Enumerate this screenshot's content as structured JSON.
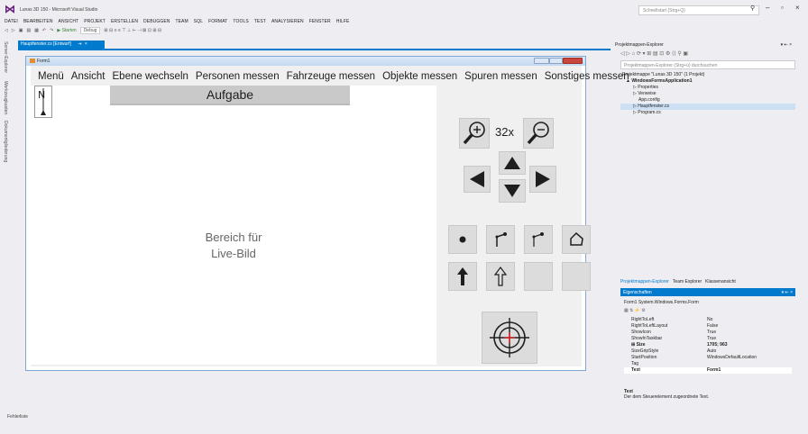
{
  "app": {
    "title": "Lunas 3D 150 - Microsoft Visual Studio",
    "quick_launch_placeholder": "Schnellstart (Strg+Q)"
  },
  "menubar": [
    "DATEI",
    "BEARBEITEN",
    "ANSICHT",
    "PROJEKT",
    "ERSTELLEN",
    "DEBUGGEN",
    "TEAM",
    "SQL",
    "FORMAT",
    "TOOLS",
    "TEST",
    "ANALYSIEREN",
    "FENSTER",
    "HILFE"
  ],
  "toolbar": {
    "start_label": "▶ Starten",
    "config_value": "Debug"
  },
  "left_strip": {
    "tabs": [
      "Server-Explorer",
      "Werkzeugkasten",
      "Dokumentgliederung"
    ]
  },
  "document": {
    "tab_label": "Hauptfenster.cs [Entwurf]"
  },
  "form": {
    "title": "Form1",
    "menu": [
      "Menü",
      "Ansicht",
      "Ebene wechseln",
      "Personen messen",
      "Fahrzeuge messen",
      "Objekte messen",
      "Spuren messen",
      "Sonstiges messen"
    ],
    "task_label": "Aufgabe",
    "live_label_line1": "Bereich für",
    "live_label_line2": "Live-Bild",
    "zoom_value": "32x"
  },
  "solution_explorer": {
    "title": "Projektmappen-Explorer",
    "search_placeholder": "Projektmappen-Explorer (Strg+ü) durchsuchen",
    "tree": [
      {
        "label": "Projektmappe \"Lunas 3D 150\" (1 Projekt)",
        "indent": 0,
        "selected": false
      },
      {
        "label": "▲ WindowsFormsApplication1",
        "indent": 1,
        "selected": false
      },
      {
        "label": "▷ Properties",
        "indent": 2,
        "selected": false
      },
      {
        "label": "▷ Verweise",
        "indent": 2,
        "selected": false
      },
      {
        "label": "App.config",
        "indent": 3,
        "selected": false
      },
      {
        "label": "▷ Hauptfenster.cs",
        "indent": 2,
        "selected": true
      },
      {
        "label": "▷ Program.cs",
        "indent": 2,
        "selected": false
      }
    ],
    "bottom_tabs": [
      "Projektmappen-Explorer",
      "Team Explorer",
      "Klassenansicht"
    ]
  },
  "properties": {
    "title": "Eigenschaften",
    "object": "Form1 System.Windows.Forms.Form",
    "rows": [
      {
        "key": "RightToLeft",
        "value": "No"
      },
      {
        "key": "RightToLeftLayout",
        "value": "False"
      },
      {
        "key": "ShowIcon",
        "value": "True"
      },
      {
        "key": "ShowInTaskbar",
        "value": "True"
      },
      {
        "key": "⊞ Size",
        "value": "1705; 963"
      },
      {
        "key": "SizeGripStyle",
        "value": "Auto"
      },
      {
        "key": "StartPosition",
        "value": "WindowsDefaultLocation"
      },
      {
        "key": "Tag",
        "value": ""
      },
      {
        "key": "Text",
        "value": "Form1"
      }
    ],
    "desc_title": "Text",
    "desc_text": "Der dem Steuerelement zugeordnete Text."
  },
  "bottom": {
    "error_list": "Fehlerliste"
  }
}
